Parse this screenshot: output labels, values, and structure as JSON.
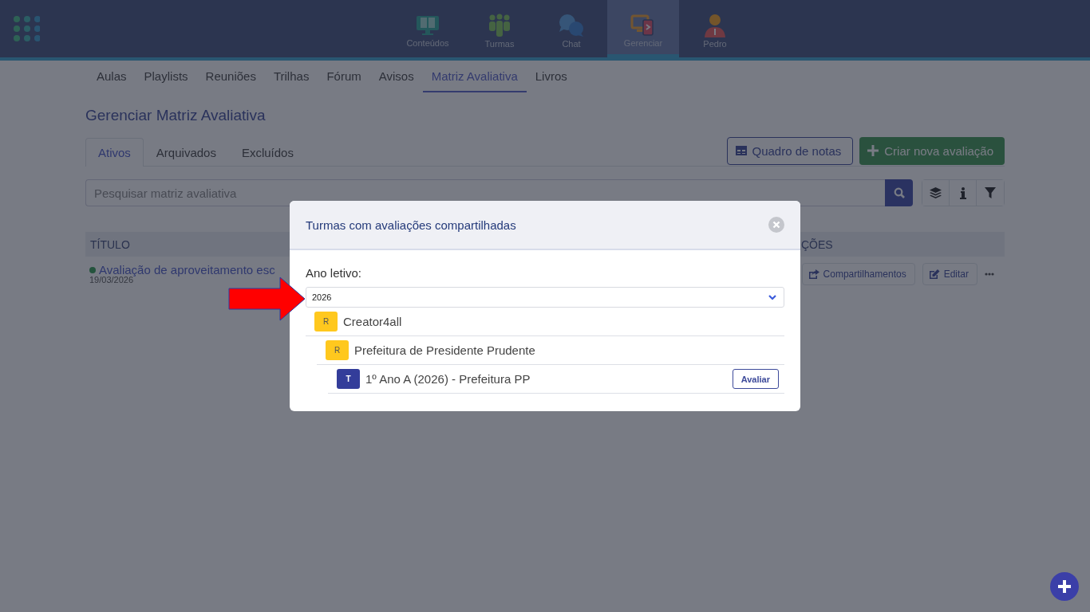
{
  "top_nav": [
    {
      "label": "Conteúdos",
      "kind": "contents",
      "selected": false
    },
    {
      "label": "Turmas",
      "kind": "classes",
      "selected": false
    },
    {
      "label": "Chat",
      "kind": "chat",
      "selected": false
    },
    {
      "label": "Gerenciar",
      "kind": "manage",
      "selected": true
    },
    {
      "label": "Pedro",
      "kind": "profile",
      "selected": false
    }
  ],
  "section_tabs": [
    {
      "label": "Aulas",
      "selected": false
    },
    {
      "label": "Playlists",
      "selected": false
    },
    {
      "label": "Reuniões",
      "selected": false
    },
    {
      "label": "Trilhas",
      "selected": false
    },
    {
      "label": "Fórum",
      "selected": false
    },
    {
      "label": "Avisos",
      "selected": false
    },
    {
      "label": "Matriz Avaliativa",
      "selected": true
    },
    {
      "label": "Livros",
      "selected": false
    }
  ],
  "page_title": "Gerenciar Matriz Avaliativa",
  "status_tabs": [
    {
      "label": "Ativos",
      "selected": true
    },
    {
      "label": "Arquivados",
      "selected": false
    },
    {
      "label": "Excluídos",
      "selected": false
    }
  ],
  "buttons": {
    "grade_board": "Quadro de notas",
    "create": "Criar nova avaliação"
  },
  "search": {
    "placeholder": "Pesquisar matriz avaliativa"
  },
  "table": {
    "columns": [
      "TÍTULO",
      "ÇÕES"
    ],
    "rows": [
      {
        "title": "Avaliação de aproveitamento esc",
        "date": "19/03/2026",
        "color": "#24533d",
        "actions": [
          "Compartilhamentos",
          "Editar"
        ]
      }
    ]
  },
  "modal": {
    "title": "Turmas com avaliações compartilhadas",
    "year_label": "Ano letivo:",
    "year_value": "2026",
    "tree": [
      {
        "badge": "R",
        "kind": "group",
        "name": "Creator4all",
        "children": [
          {
            "badge": "R",
            "kind": "group",
            "name": "Prefeitura de Presidente Prudente",
            "children": [
              {
                "badge": "T",
                "kind": "class",
                "name": "1º Ano A (2026) - Prefeitura PP",
                "action": "Avaliar"
              }
            ]
          }
        ]
      }
    ]
  }
}
